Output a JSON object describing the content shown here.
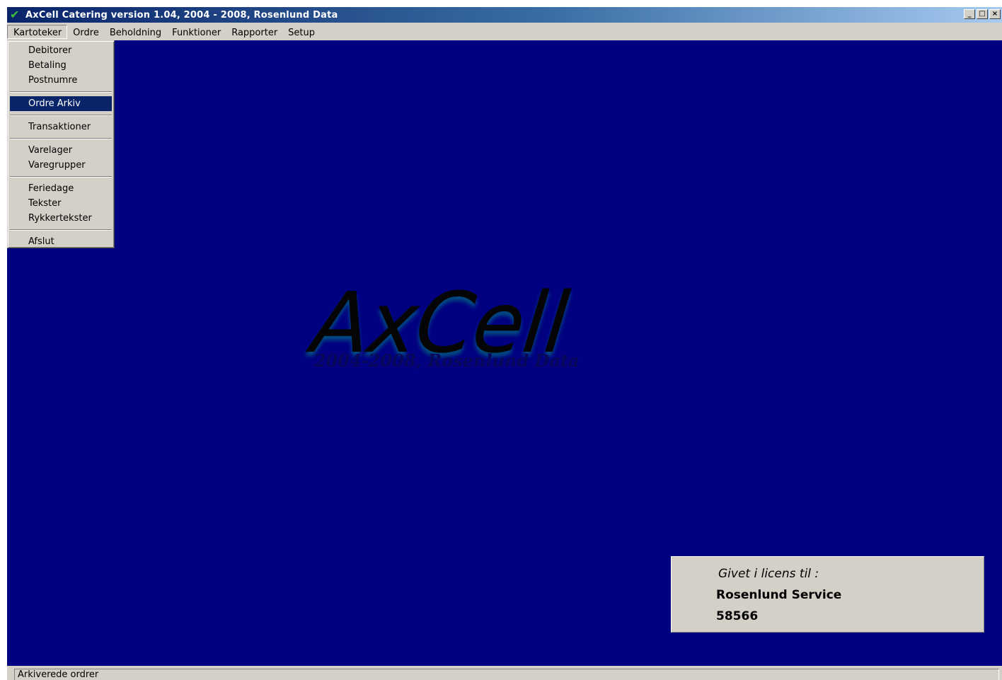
{
  "window": {
    "title": "AxCell Catering version 1.04, 2004 - 2008, Rosenlund Data",
    "icon": "green-checkmark-icon",
    "controls": {
      "minimize": "_",
      "maximize": "□",
      "close": "×"
    }
  },
  "menubar": {
    "items": [
      {
        "label": "Kartoteker"
      },
      {
        "label": "Ordre"
      },
      {
        "label": "Beholdning"
      },
      {
        "label": "Funktioner"
      },
      {
        "label": "Rapporter"
      },
      {
        "label": "Setup"
      }
    ]
  },
  "dropdown": {
    "open_menu": "Kartoteker",
    "items": {
      "debitorer": "Debitorer",
      "betaling": "Betaling",
      "postnumre": "Postnumre",
      "ordre_arkiv": "Ordre Arkiv",
      "transaktioner": "Transaktioner",
      "varelager": "Varelager",
      "varegrupper": "Varegrupper",
      "feriedage": "Feriedage",
      "tekster": "Tekster",
      "rykkertekster": "Rykkertekster",
      "afslut": "Afslut"
    },
    "selected": "Ordre Arkiv"
  },
  "logo": {
    "main": "AxCell",
    "sub": "2004-2008, Rosenlund Data"
  },
  "license": {
    "label": "Givet i licens til :",
    "name": "Rosenlund Service",
    "number": "58566"
  },
  "statusbar": {
    "text": "Arkiverede ordrer"
  },
  "colors": {
    "desktop": "#000080",
    "titlebar_start": "#0a246a",
    "titlebar_end": "#a6caf0",
    "menu_bg": "#d4d0c8",
    "selection": "#0a246a"
  }
}
